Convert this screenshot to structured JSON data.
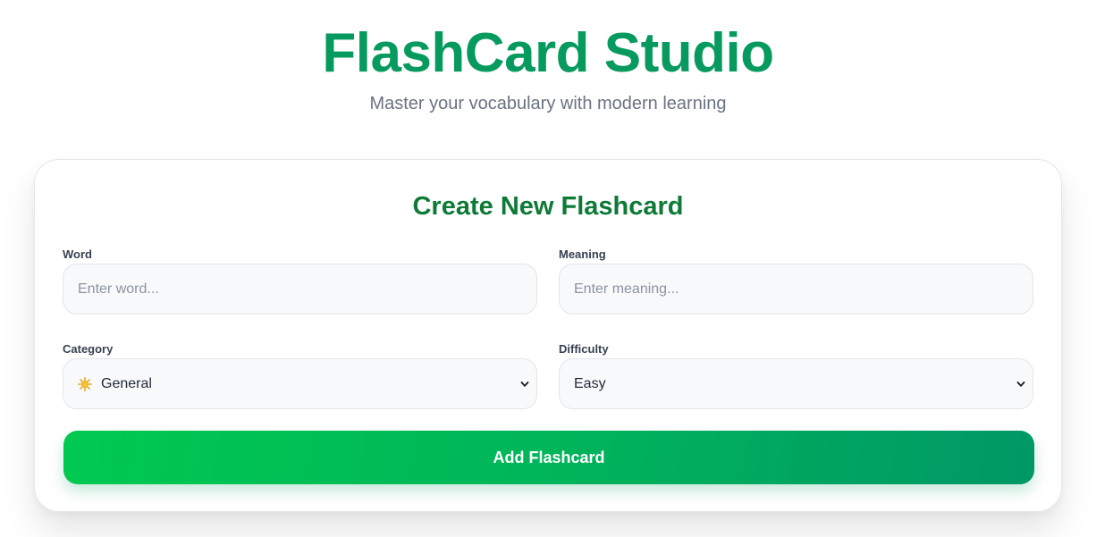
{
  "header": {
    "title": "FlashCard Studio",
    "subtitle": "Master your vocabulary with modern learning"
  },
  "form": {
    "title": "Create New Flashcard",
    "word": {
      "label": "Word",
      "placeholder": "Enter word...",
      "value": ""
    },
    "meaning": {
      "label": "Meaning",
      "placeholder": "Enter meaning...",
      "value": ""
    },
    "category": {
      "label": "Category",
      "selected_icon": "sun-icon",
      "selected_value": "General"
    },
    "difficulty": {
      "label": "Difficulty",
      "selected_value": "Easy"
    },
    "submit_label": "Add Flashcard"
  },
  "colors": {
    "brand_green": "#079a5e",
    "card_title_green": "#0e7a37",
    "button_gradient_start": "#00c950",
    "button_gradient_end": "#009866"
  }
}
